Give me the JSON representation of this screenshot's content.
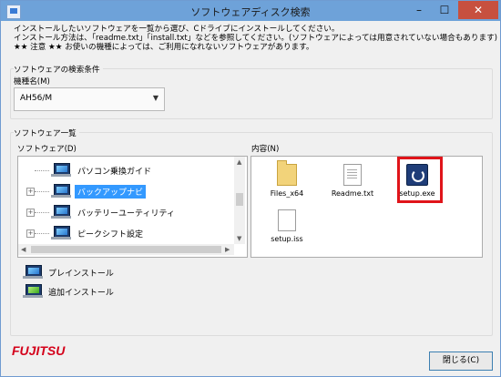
{
  "window": {
    "title": "ソフトウェアディスク検索",
    "controls": {
      "minimize": "–",
      "maximize": "☐",
      "close": "✕"
    }
  },
  "intro": {
    "line1": "インストールしたいソフトウェアを一覧から選び、Cドライブにインストールしてください。",
    "line2": "インストール方法は、「readme.txt」「install.txt」などを参照してください。(ソフトウェアによっては用意されていない場合もあります)",
    "line3": "★★ 注意 ★★ お使いの機種によっては、ご利用になれないソフトウェアがあります。"
  },
  "search": {
    "group_title": "ソフトウェアの検索条件",
    "model_label": "機種名(M)",
    "model_value": "AH56/M"
  },
  "list": {
    "group_title": "ソフトウェア一覧",
    "software_label": "ソフトウェア(D)",
    "content_label": "内容(N)",
    "software_items": [
      {
        "label": "パソコン乗換ガイド",
        "icon": "laptop-icon",
        "expander": ""
      },
      {
        "label": "バックアップナビ",
        "icon": "laptop-icon",
        "expander": "+"
      },
      {
        "label": "バッテリーユーティリティ",
        "icon": "laptop-icon",
        "expander": "+"
      },
      {
        "label": "ピークシフト設定",
        "icon": "laptop-icon",
        "expander": "+"
      }
    ],
    "content_items": [
      {
        "name": "Files_x64",
        "icon": "folder-icon"
      },
      {
        "name": "Readme.txt",
        "icon": "text-file-icon"
      },
      {
        "name": "setup.exe",
        "icon": "setup-exe-icon",
        "highlighted": true
      },
      {
        "name": "setup.iss",
        "icon": "file-icon"
      }
    ]
  },
  "legend": {
    "preinstall": "プレインストール",
    "additional": "追加インストール"
  },
  "footer": {
    "brand": "FUJITSU",
    "close_button": "閉じる(C)"
  },
  "colors": {
    "titlebar": "#6ea2d9",
    "selection": "#3399ff",
    "highlight_border": "#e0141a",
    "brand": "#d4001a"
  }
}
